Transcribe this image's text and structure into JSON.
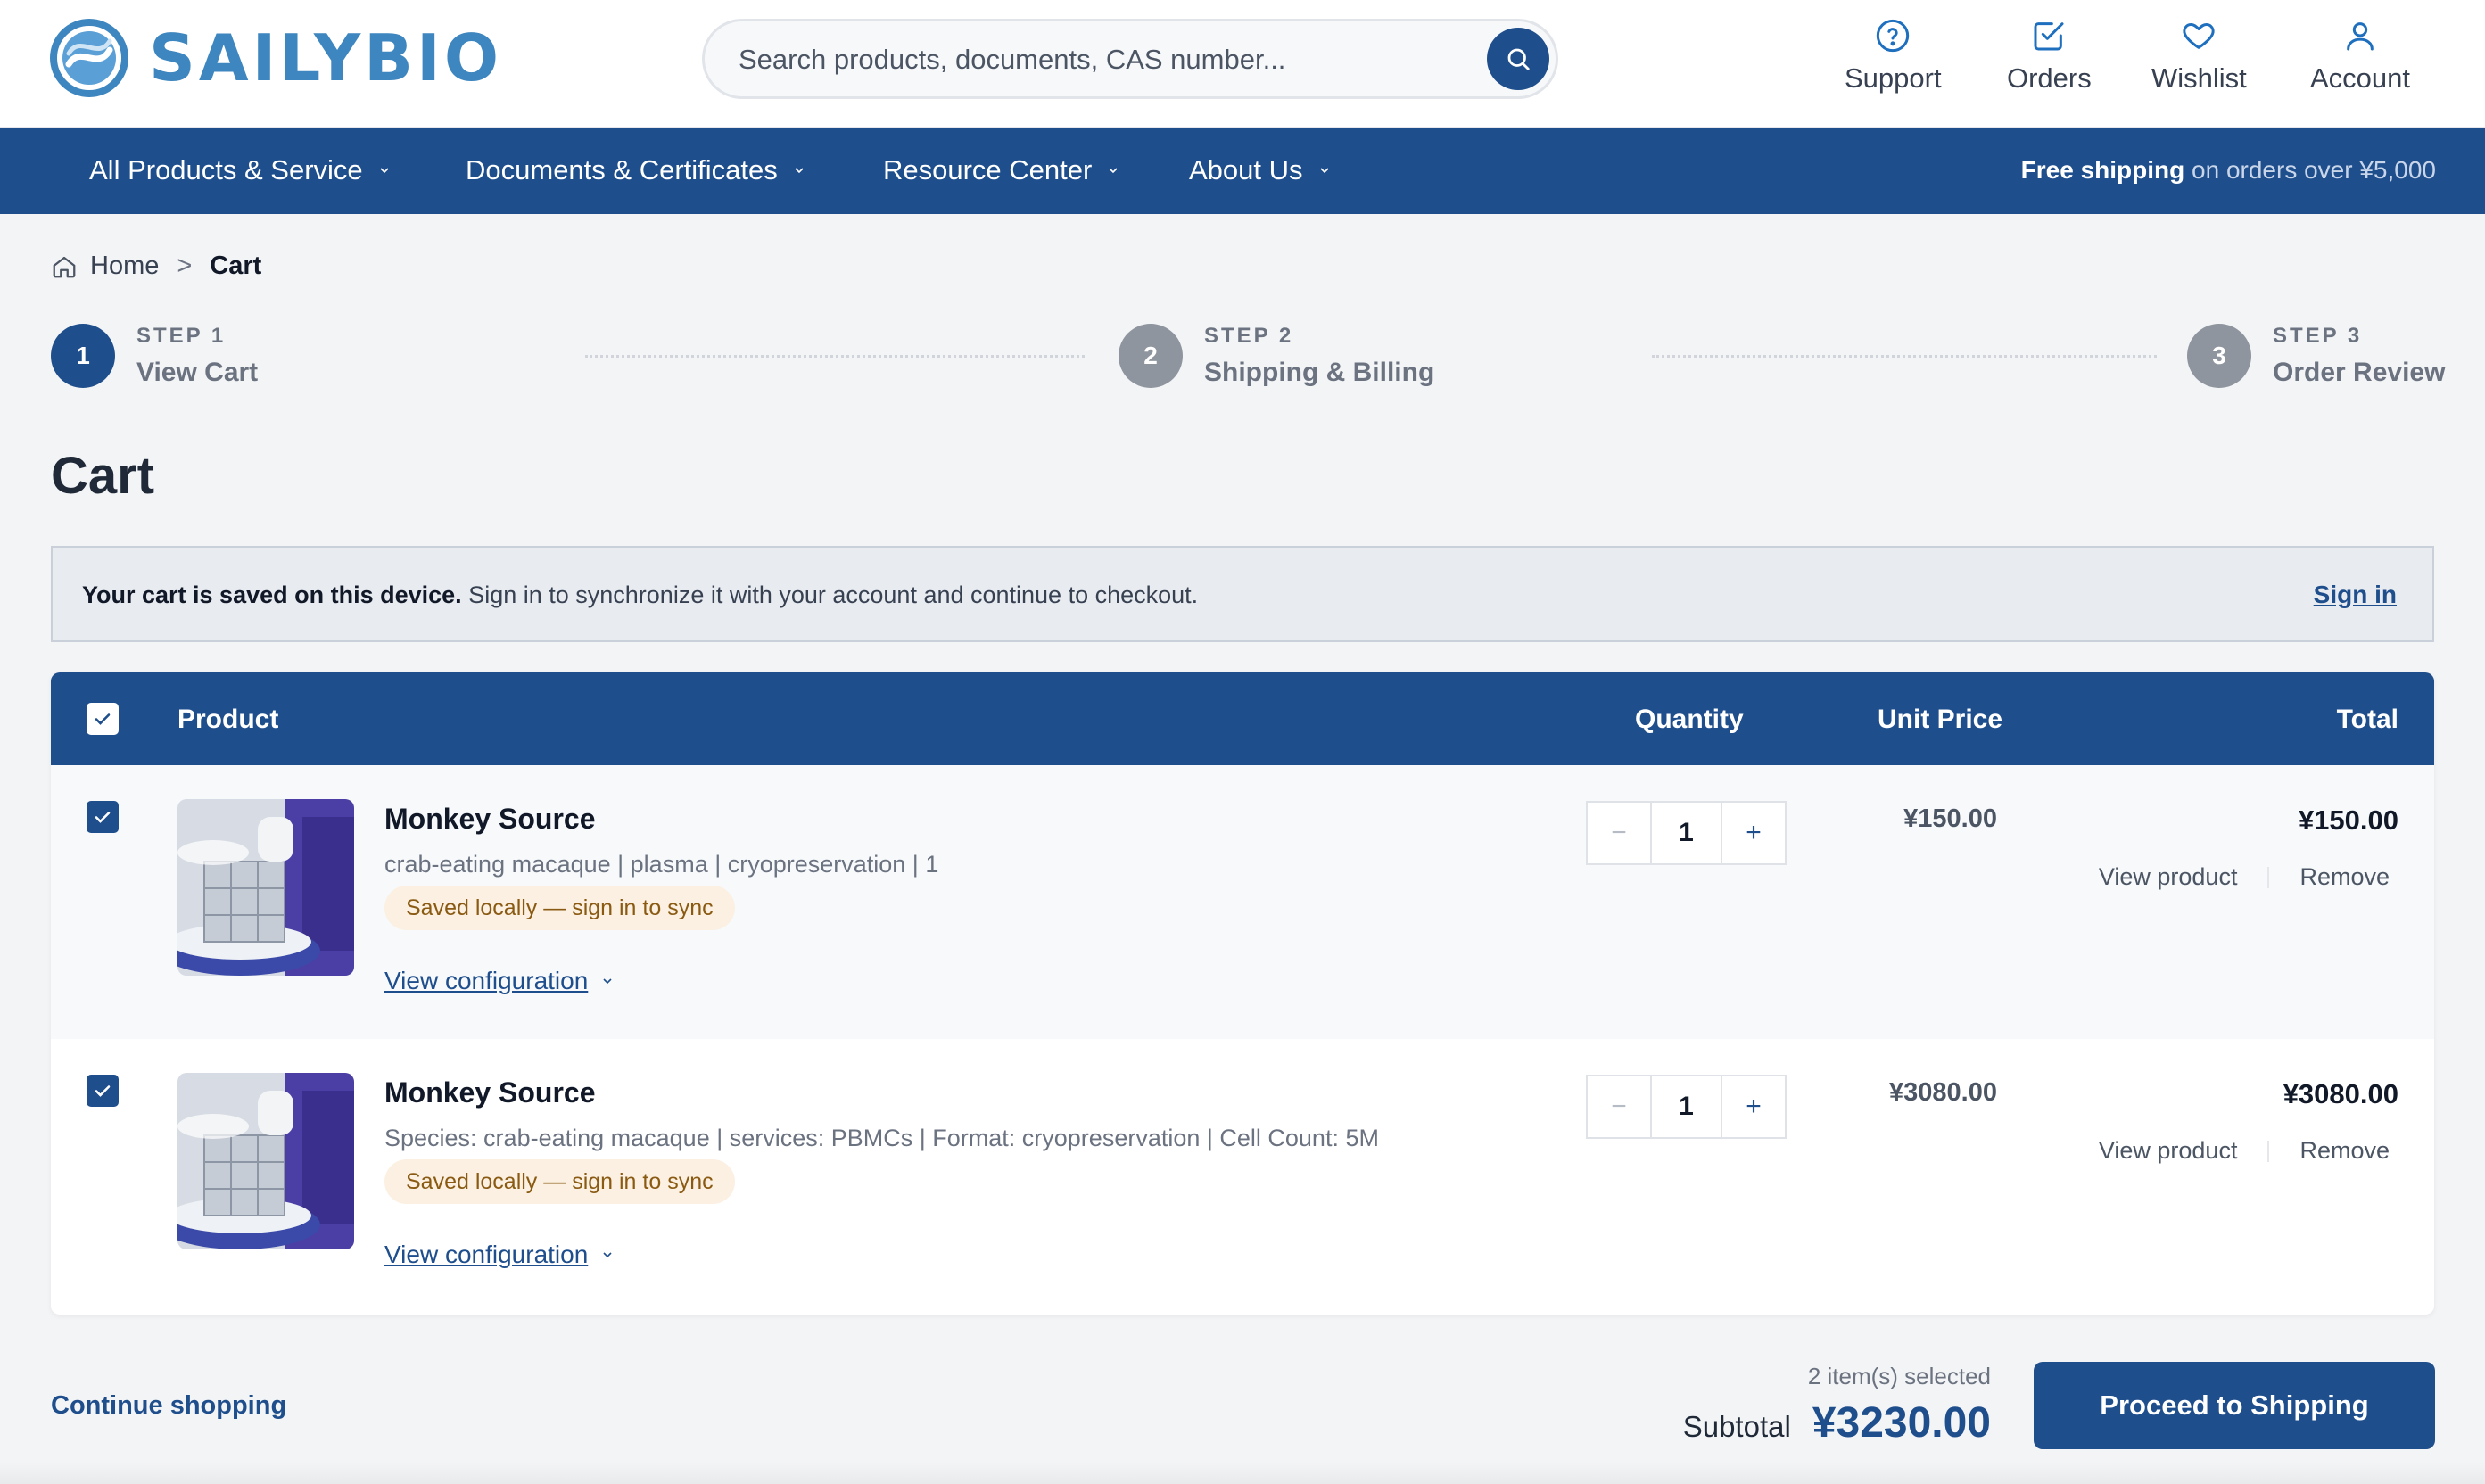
{
  "brand": {
    "name": "SAILYBIO",
    "accent": "#1f4e8c",
    "logo_color": "#3d86bf"
  },
  "search": {
    "placeholder": "Search products, documents, CAS number..."
  },
  "header_nav": [
    {
      "label": "Support",
      "icon": "help-circle-icon"
    },
    {
      "label": "Orders",
      "icon": "check-square-icon"
    },
    {
      "label": "Wishlist",
      "icon": "heart-icon"
    },
    {
      "label": "Account",
      "icon": "user-icon"
    }
  ],
  "menu": [
    {
      "label": "All Products & Service"
    },
    {
      "label": "Documents & Certificates"
    },
    {
      "label": "Resource Center"
    },
    {
      "label": "About Us"
    }
  ],
  "shipping_note": {
    "bold": "Free shipping",
    "rest": "on orders over ¥5,000"
  },
  "breadcrumb": {
    "home": "Home",
    "separator": ">",
    "current": "Cart"
  },
  "steps": [
    {
      "number": "1",
      "step_label": "STEP 1",
      "title": "View Cart",
      "state": "active"
    },
    {
      "number": "2",
      "step_label": "STEP 2",
      "title": "Shipping & Billing",
      "state": "pending"
    },
    {
      "number": "3",
      "step_label": "STEP 3",
      "title": "Order Review",
      "state": "pending"
    }
  ],
  "page_title": "Cart",
  "banner": {
    "bold": "Your cart is saved on this device.",
    "text": "Sign in to synchronize it with your account and continue to checkout.",
    "link": "Sign in"
  },
  "table": {
    "headers": {
      "product": "Product",
      "quantity": "Quantity",
      "unit_price": "Unit Price",
      "total": "Total"
    },
    "select_all_checked": true
  },
  "items": [
    {
      "name": "Monkey Source",
      "description": "crab-eating macaque | plasma | cryopreservation | 1",
      "badge": "Saved locally — sign in to sync",
      "config_link": "View configuration",
      "quantity": "1",
      "unit_price": "¥150.00",
      "total": "¥150.00",
      "view_label": "View product",
      "remove_label": "Remove",
      "checked": true
    },
    {
      "name": "Monkey Source",
      "description": "Species: crab-eating macaque | services: PBMCs | Format: cryopreservation | Cell Count: 5M",
      "badge": "Saved locally — sign in to sync",
      "config_link": "View configuration",
      "quantity": "1",
      "unit_price": "¥3080.00",
      "total": "¥3080.00",
      "view_label": "View product",
      "remove_label": "Remove",
      "checked": true
    }
  ],
  "summary": {
    "continue": "Continue shopping",
    "selected": "2 item(s) selected",
    "subtotal_label": "Subtotal",
    "subtotal": "¥3230.00",
    "proceed": "Proceed to Shipping"
  }
}
